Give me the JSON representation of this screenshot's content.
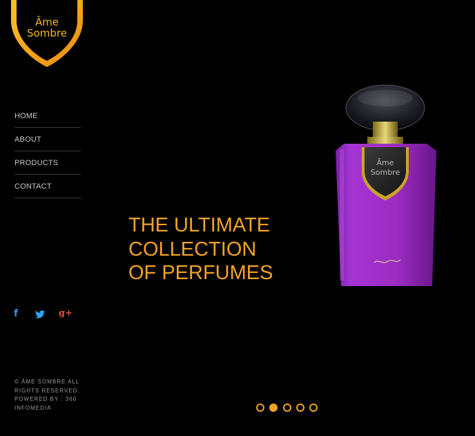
{
  "brand": {
    "line1": "Ãme",
    "line2": "Sombre",
    "gold": "#f1b82b"
  },
  "nav": [
    {
      "label": "HOME"
    },
    {
      "label": "ABOUT"
    },
    {
      "label": "PRODUCTS"
    },
    {
      "label": "CONTACT"
    }
  ],
  "social": [
    {
      "name": "facebook-icon",
      "glyph": "f"
    },
    {
      "name": "twitter-icon",
      "glyph": ""
    },
    {
      "name": "google-plus-icon",
      "glyph": "g+"
    }
  ],
  "footer": {
    "copyright": "© ÂME SOMBRE ALL RIGHTS RESERVED.",
    "powered": "POWERED BY : 360 INFOMEDIA"
  },
  "hero": {
    "headline": [
      "THE ULTIMATE",
      "COLLECTION",
      "OF PERFUMES"
    ],
    "accent": "#f2a325",
    "bottle_label_line1": "Ãme",
    "bottle_label_line2": "Sombre",
    "bottle_color": "#9b2cc2"
  },
  "slider": {
    "count": 5,
    "active_index": 1
  }
}
